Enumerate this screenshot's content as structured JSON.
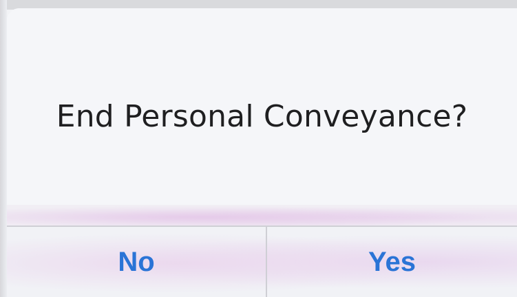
{
  "alert": {
    "title": "End Personal Conveyance?",
    "buttons": {
      "no_label": "No",
      "yes_label": "Yes"
    }
  },
  "colors": {
    "button_text": "#2a74d6",
    "title_text": "#1f1f21",
    "divider": "#cfcfd5",
    "background": "#f5f6f9"
  }
}
